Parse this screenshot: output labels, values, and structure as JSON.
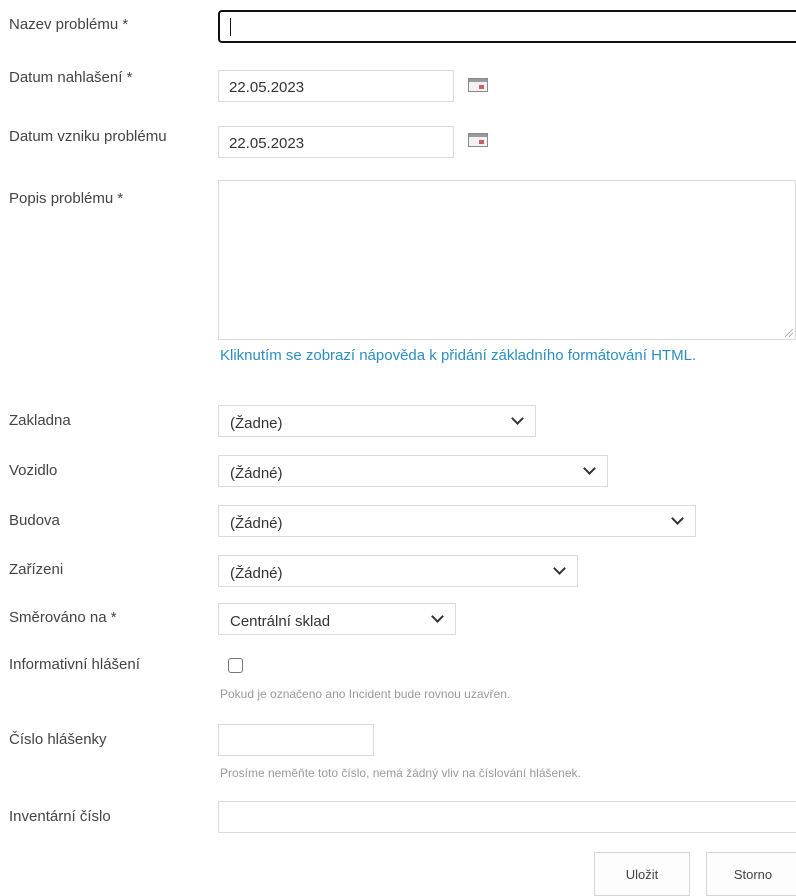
{
  "form": {
    "fields": {
      "nazev": {
        "label": "Nazev problému *",
        "value": ""
      },
      "datum_nahlaseni": {
        "label": "Datum nahlašení *",
        "value": "22.05.2023",
        "icon": "calendar-icon"
      },
      "datum_vzniku": {
        "label": "Datum vzniku problému",
        "value": "22.05.2023",
        "icon": "calendar-icon"
      },
      "popis": {
        "label": "Popis problému *",
        "value": ""
      },
      "help_link": "Kliknutím se zobrazí nápověda k přidání základního formátování HTML.",
      "zakladna": {
        "label": "Zakladna",
        "value": "(Žadne)"
      },
      "vozidlo": {
        "label": "Vozidlo",
        "value": "(Žádné)"
      },
      "budova": {
        "label": "Budova",
        "value": "(Žádné)"
      },
      "zarizeni": {
        "label": "Zařízeni",
        "value": "(Žádné)"
      },
      "smerovano": {
        "label": "Směrováno na *",
        "value": "Centrální sklad"
      },
      "informativni": {
        "label": "Informativní hlášení",
        "checked": false,
        "help": "Pokud je označeno ano Incident bude rovnou uzavřen."
      },
      "cislo_hlasenky": {
        "label": "Číslo hlášenky",
        "value": "",
        "help": "Prosíme neměňte toto číslo, nemá žádný vliv na číslování hlášenek."
      },
      "inventarni": {
        "label": "Inventární číslo",
        "value": ""
      }
    },
    "buttons": {
      "save": "Uložit",
      "cancel": "Storno"
    }
  }
}
